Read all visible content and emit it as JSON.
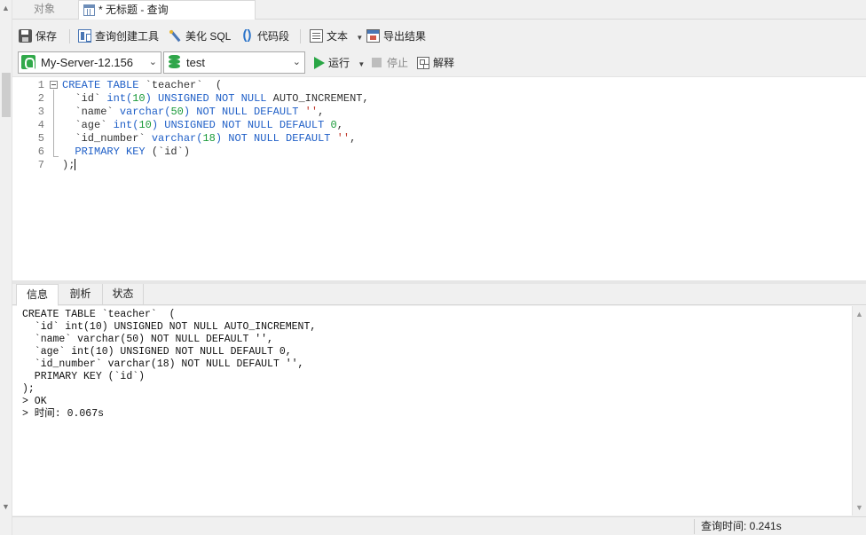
{
  "tabs": {
    "objects": "对象",
    "query": "* 无标题 - 查询"
  },
  "toolbar": {
    "save": "保存",
    "query_builder": "查询创建工具",
    "beautify_sql": "美化 SQL",
    "code_snippet": "代码段",
    "text": "文本",
    "export_results": "导出结果"
  },
  "toolbar2": {
    "connection": "My-Server-12.156",
    "database": "test",
    "run": "运行",
    "stop": "停止",
    "explain": "解释"
  },
  "editor": {
    "line_numbers": [
      "1",
      "2",
      "3",
      "4",
      "5",
      "6",
      "7"
    ],
    "l1": {
      "create": "CREATE TABLE ",
      "name": "`teacher`",
      "rest": "  ("
    },
    "l2": {
      "indent": "  ",
      "col": "`id`",
      "sp": " ",
      "type": "int(",
      "n": "10",
      "close": ") ",
      "mods": "UNSIGNED NOT NULL",
      "ai": " AUTO_INCREMENT,",
      "tail": ""
    },
    "l3": {
      "indent": "  ",
      "col": "`name`",
      "sp": " ",
      "type": "varchar(",
      "n": "50",
      "close": ") ",
      "mods": "NOT NULL DEFAULT ",
      "str": "''",
      "tail": ","
    },
    "l4": {
      "indent": "  ",
      "col": "`age`",
      "sp": " ",
      "type": "int(",
      "n": "10",
      "close": ") ",
      "mods": "UNSIGNED NOT NULL DEFAULT ",
      "num": "0",
      "tail": ","
    },
    "l5": {
      "indent": "  ",
      "col": "`id_number`",
      "sp": " ",
      "type": "varchar(",
      "n": "18",
      "close": ") ",
      "mods": "NOT NULL DEFAULT ",
      "str": "''",
      "tail": ","
    },
    "l6": {
      "indent": "  ",
      "pk": "PRIMARY KEY",
      "rest": " (`id`)"
    },
    "l7": {
      "text": ");"
    }
  },
  "bottom_tabs": {
    "info": "信息",
    "profile": "剖析",
    "status": "状态"
  },
  "output_lines": [
    "CREATE TABLE `teacher`  (",
    "  `id` int(10) UNSIGNED NOT NULL AUTO_INCREMENT,",
    "  `name` varchar(50) NOT NULL DEFAULT '',",
    "  `age` int(10) UNSIGNED NOT NULL DEFAULT 0,",
    "  `id_number` varchar(18) NOT NULL DEFAULT '',",
    "  PRIMARY KEY (`id`)",
    ");",
    "> OK",
    "> 时间: 0.067s"
  ],
  "statusbar": {
    "query_time": "查询时间: 0.241s"
  }
}
